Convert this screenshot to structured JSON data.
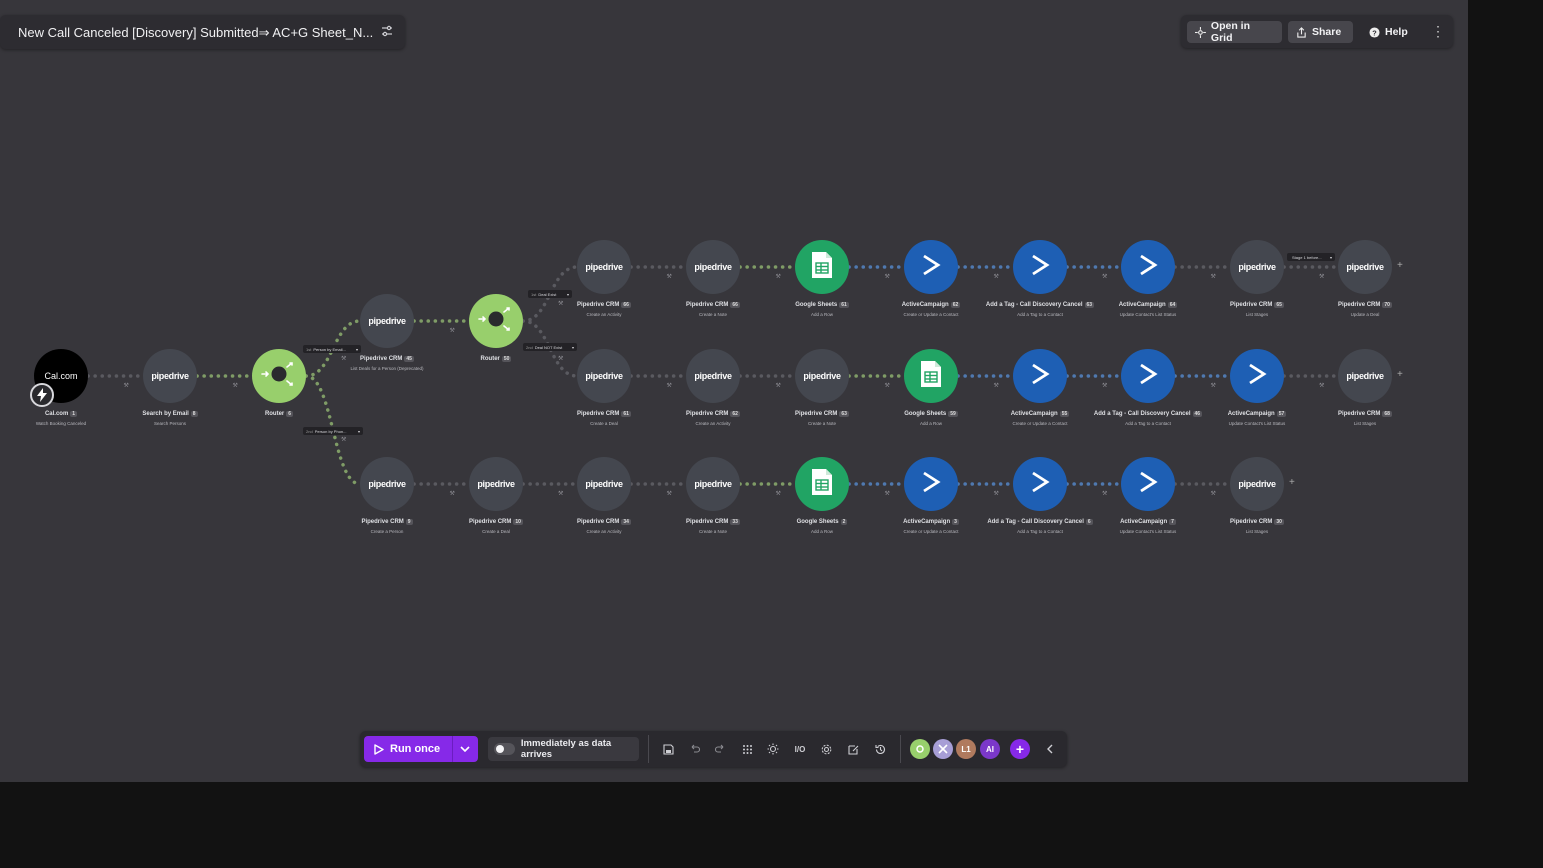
{
  "scenario": {
    "title": "New Call Canceled [Discovery] Submitted⇒ AC+G Sheet_N..."
  },
  "header_actions": {
    "open_grid": "Open in Grid",
    "share": "Share",
    "help": "Help"
  },
  "colors": {
    "pipedrive": "#44474f",
    "sheets": "#21a464",
    "activecampaign": "#1e5fb4",
    "router": "#98cf6c",
    "run_button": "#8629e8"
  },
  "app_logos": {
    "pipedrive": "pipedrive",
    "calcom": "Cal.com"
  },
  "modules": [
    {
      "id": "cal",
      "app": "calcom",
      "title": "Cal.com",
      "num": "1",
      "sub": "Watch Booking Canceled"
    },
    {
      "id": "search",
      "app": "pipedrive",
      "title": "Search by Email",
      "num": "8",
      "sub": "Search Persons"
    },
    {
      "id": "router1",
      "app": "router",
      "title": "Router",
      "num": "6",
      "sub": ""
    },
    {
      "id": "pd45",
      "app": "pipedrive",
      "title": "Pipedrive CRM",
      "num": "45",
      "sub": "List Deals for a Person (Deprecated)"
    },
    {
      "id": "router2",
      "app": "router",
      "title": "Router",
      "num": "50",
      "sub": ""
    },
    {
      "id": "r1a",
      "app": "pipedrive",
      "title": "Pipedrive CRM",
      "num": "66",
      "sub": "Create an Activity"
    },
    {
      "id": "r1b",
      "app": "pipedrive",
      "title": "Pipedrive CRM",
      "num": "66",
      "sub": "Create a Note"
    },
    {
      "id": "r1c",
      "app": "sheets",
      "title": "Google Sheets",
      "num": "61",
      "sub": "Add a Row"
    },
    {
      "id": "r1d",
      "app": "activecampaign",
      "title": "ActiveCampaign",
      "num": "62",
      "sub": "Create or Update a Contact"
    },
    {
      "id": "r1e",
      "app": "activecampaign",
      "title": "Add a Tag - Call Discovery Cancel",
      "num": "63",
      "sub": "Add a Tag to a Contact"
    },
    {
      "id": "r1f",
      "app": "activecampaign",
      "title": "ActiveCampaign",
      "num": "64",
      "sub": "Update Contact's List Status"
    },
    {
      "id": "r1g",
      "app": "pipedrive",
      "title": "Pipedrive CRM",
      "num": "65",
      "sub": "List Stages"
    },
    {
      "id": "r1h",
      "app": "pipedrive",
      "title": "Pipedrive CRM",
      "num": "70",
      "sub": "Update a Deal"
    },
    {
      "id": "r2a",
      "app": "pipedrive",
      "title": "Pipedrive CRM",
      "num": "61",
      "sub": "Create a Deal"
    },
    {
      "id": "r2b",
      "app": "pipedrive",
      "title": "Pipedrive CRM",
      "num": "62",
      "sub": "Create an Activity"
    },
    {
      "id": "r2c",
      "app": "pipedrive",
      "title": "Pipedrive CRM",
      "num": "63",
      "sub": "Create a Note"
    },
    {
      "id": "r2d",
      "app": "sheets",
      "title": "Google Sheets",
      "num": "59",
      "sub": "Add a Row"
    },
    {
      "id": "r2e",
      "app": "activecampaign",
      "title": "ActiveCampaign",
      "num": "55",
      "sub": "Create or Update a Contact"
    },
    {
      "id": "r2f",
      "app": "activecampaign",
      "title": "Add a Tag - Call Discovery Cancel",
      "num": "46",
      "sub": "Add a Tag to a Contact"
    },
    {
      "id": "r2g",
      "app": "activecampaign",
      "title": "ActiveCampaign",
      "num": "57",
      "sub": "Update Contact's List Status"
    },
    {
      "id": "r2h",
      "app": "pipedrive",
      "title": "Pipedrive CRM",
      "num": "68",
      "sub": "List Stages"
    },
    {
      "id": "r3a",
      "app": "pipedrive",
      "title": "Pipedrive CRM",
      "num": "9",
      "sub": "Create a Person"
    },
    {
      "id": "r3b",
      "app": "pipedrive",
      "title": "Pipedrive CRM",
      "num": "10",
      "sub": "Create a Deal"
    },
    {
      "id": "r3c",
      "app": "pipedrive",
      "title": "Pipedrive CRM",
      "num": "34",
      "sub": "Create an Activity"
    },
    {
      "id": "r3d",
      "app": "pipedrive",
      "title": "Pipedrive CRM",
      "num": "33",
      "sub": "Create a Note"
    },
    {
      "id": "r3e",
      "app": "sheets",
      "title": "Google Sheets",
      "num": "2",
      "sub": "Add a Row"
    },
    {
      "id": "r3f",
      "app": "activecampaign",
      "title": "ActiveCampaign",
      "num": "3",
      "sub": "Create or Update a Contact"
    },
    {
      "id": "r3g",
      "app": "activecampaign",
      "title": "Add a Tag - Call Discovery Cancel",
      "num": "6",
      "sub": "Add a Tag to a Contact"
    },
    {
      "id": "r3h",
      "app": "activecampaign",
      "title": "ActiveCampaign",
      "num": "7",
      "sub": "Update Contact's List Status"
    },
    {
      "id": "r3i",
      "app": "pipedrive",
      "title": "Pipedrive CRM",
      "num": "30",
      "sub": "List Stages"
    }
  ],
  "filters": [
    {
      "id": "f1",
      "num": "1st",
      "label": "Person by Email..."
    },
    {
      "id": "f2",
      "num": "2nd",
      "label": "Person by Phon..."
    },
    {
      "id": "f3",
      "num": "1st",
      "label": "Deal Exist"
    },
    {
      "id": "f4",
      "num": "2nd",
      "label": "Deal NOT Exist"
    },
    {
      "id": "f5",
      "num": "",
      "label": "Stage 1 before..."
    }
  ],
  "toolbar": {
    "run_once": "Run once",
    "schedule_label": "Immediately as data arrives",
    "io_label": "I/O",
    "avatar_initials": "L1",
    "ai_label": "AI"
  }
}
